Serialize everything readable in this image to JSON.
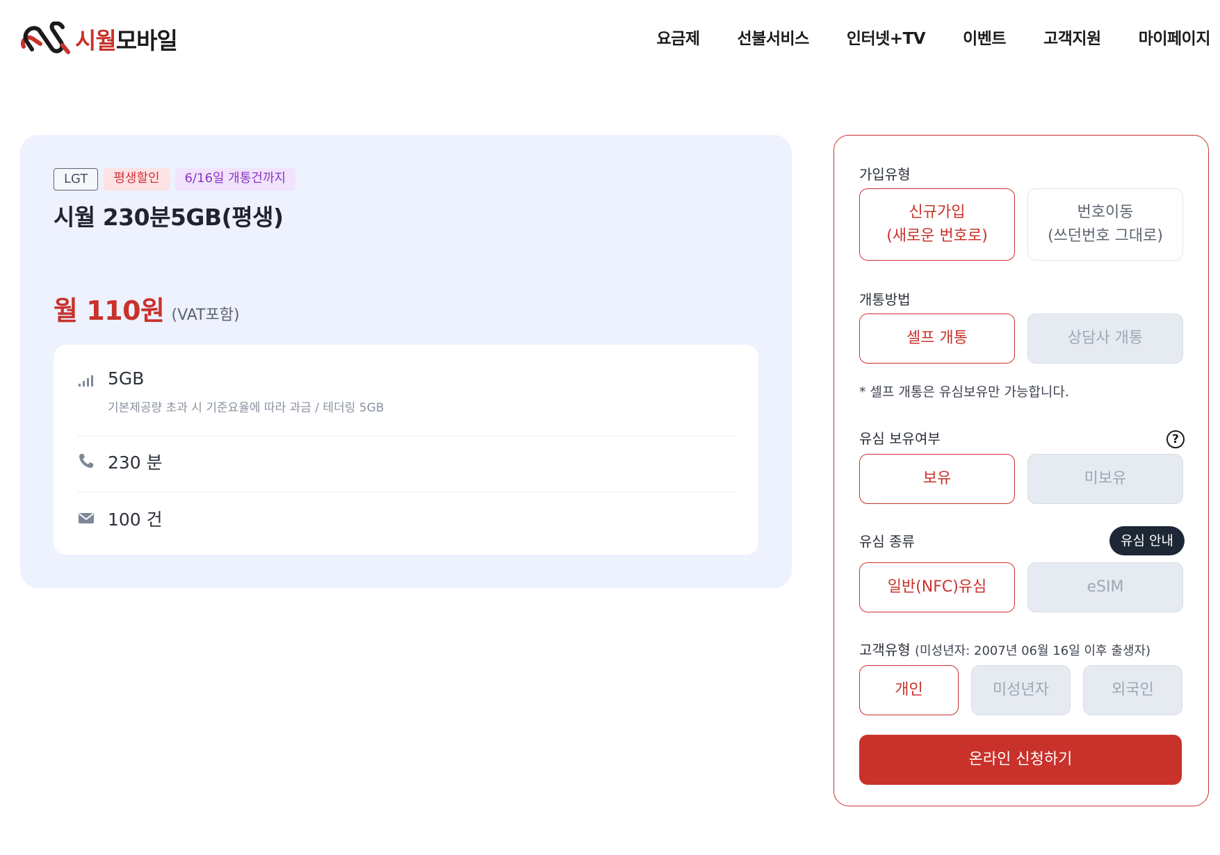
{
  "header": {
    "logo": {
      "text_red": "시월",
      "text_dark": "모바일"
    },
    "nav": [
      "요금제",
      "선불서비스",
      "인터넷+TV",
      "이벤트",
      "고객지원",
      "마이페이지"
    ]
  },
  "plan": {
    "badges": {
      "carrier": "LGT",
      "discount": "평생할인",
      "deadline": "6/16일 개통건까지"
    },
    "title": "시월 230분5GB(평생)",
    "price": "월 110원",
    "vat": "(VAT포함)",
    "specs": {
      "data": {
        "main": "5GB",
        "sub": "기본제공량 초과 시 기준요율에 따라 과금 / 테더링 5GB"
      },
      "voice": {
        "main": "230 분"
      },
      "sms": {
        "main": "100 건"
      }
    }
  },
  "form": {
    "join_type": {
      "label": "가입유형",
      "new": {
        "line1": "신규가입",
        "line2": "(새로운 번호로)"
      },
      "port": {
        "line1": "번호이동",
        "line2": "(쓰던번호 그대로)"
      }
    },
    "activation": {
      "label": "개통방법",
      "self": "셀프 개통",
      "agent": "상담사 개통",
      "note": "* 셀프 개통은 유심보유만 가능합니다."
    },
    "usim_owned": {
      "label": "유심 보유여부",
      "help": "?",
      "yes": "보유",
      "no": "미보유"
    },
    "usim_type": {
      "label": "유심 종류",
      "guide": "유심 안내",
      "nfc": "일반(NFC)유심",
      "esim": "eSIM"
    },
    "customer": {
      "label": "고객유형",
      "label_note": "(미성년자: 2007년 06월 16일 이후 출생자)",
      "personal": "개인",
      "minor": "미성년자",
      "foreigner": "외국인"
    },
    "submit": "온라인 신청하기"
  },
  "colors": {
    "accent": "#c8322b",
    "card_bg": "#eef1fe",
    "dark_pill": "#1e2735"
  }
}
